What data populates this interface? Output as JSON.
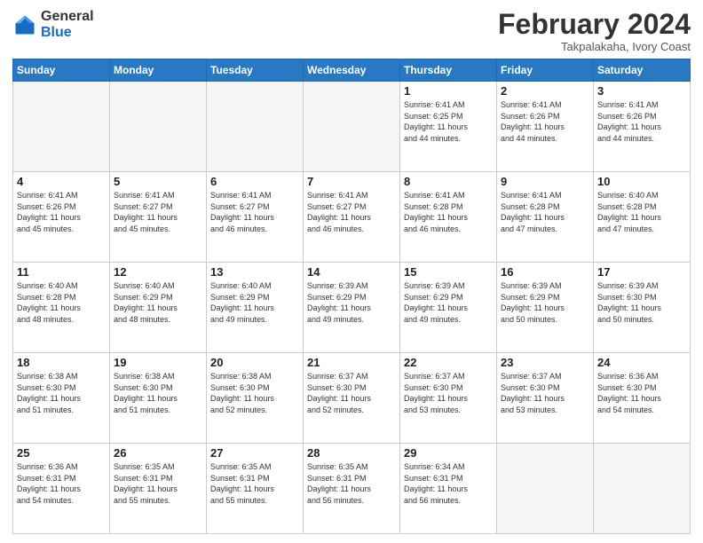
{
  "logo": {
    "general": "General",
    "blue": "Blue"
  },
  "header": {
    "title": "February 2024",
    "subtitle": "Takpalakaha, Ivory Coast"
  },
  "weekdays": [
    "Sunday",
    "Monday",
    "Tuesday",
    "Wednesday",
    "Thursday",
    "Friday",
    "Saturday"
  ],
  "weeks": [
    [
      {
        "day": "",
        "info": ""
      },
      {
        "day": "",
        "info": ""
      },
      {
        "day": "",
        "info": ""
      },
      {
        "day": "",
        "info": ""
      },
      {
        "day": "1",
        "info": "Sunrise: 6:41 AM\nSunset: 6:25 PM\nDaylight: 11 hours\nand 44 minutes."
      },
      {
        "day": "2",
        "info": "Sunrise: 6:41 AM\nSunset: 6:26 PM\nDaylight: 11 hours\nand 44 minutes."
      },
      {
        "day": "3",
        "info": "Sunrise: 6:41 AM\nSunset: 6:26 PM\nDaylight: 11 hours\nand 44 minutes."
      }
    ],
    [
      {
        "day": "4",
        "info": "Sunrise: 6:41 AM\nSunset: 6:26 PM\nDaylight: 11 hours\nand 45 minutes."
      },
      {
        "day": "5",
        "info": "Sunrise: 6:41 AM\nSunset: 6:27 PM\nDaylight: 11 hours\nand 45 minutes."
      },
      {
        "day": "6",
        "info": "Sunrise: 6:41 AM\nSunset: 6:27 PM\nDaylight: 11 hours\nand 46 minutes."
      },
      {
        "day": "7",
        "info": "Sunrise: 6:41 AM\nSunset: 6:27 PM\nDaylight: 11 hours\nand 46 minutes."
      },
      {
        "day": "8",
        "info": "Sunrise: 6:41 AM\nSunset: 6:28 PM\nDaylight: 11 hours\nand 46 minutes."
      },
      {
        "day": "9",
        "info": "Sunrise: 6:41 AM\nSunset: 6:28 PM\nDaylight: 11 hours\nand 47 minutes."
      },
      {
        "day": "10",
        "info": "Sunrise: 6:40 AM\nSunset: 6:28 PM\nDaylight: 11 hours\nand 47 minutes."
      }
    ],
    [
      {
        "day": "11",
        "info": "Sunrise: 6:40 AM\nSunset: 6:28 PM\nDaylight: 11 hours\nand 48 minutes."
      },
      {
        "day": "12",
        "info": "Sunrise: 6:40 AM\nSunset: 6:29 PM\nDaylight: 11 hours\nand 48 minutes."
      },
      {
        "day": "13",
        "info": "Sunrise: 6:40 AM\nSunset: 6:29 PM\nDaylight: 11 hours\nand 49 minutes."
      },
      {
        "day": "14",
        "info": "Sunrise: 6:39 AM\nSunset: 6:29 PM\nDaylight: 11 hours\nand 49 minutes."
      },
      {
        "day": "15",
        "info": "Sunrise: 6:39 AM\nSunset: 6:29 PM\nDaylight: 11 hours\nand 49 minutes."
      },
      {
        "day": "16",
        "info": "Sunrise: 6:39 AM\nSunset: 6:29 PM\nDaylight: 11 hours\nand 50 minutes."
      },
      {
        "day": "17",
        "info": "Sunrise: 6:39 AM\nSunset: 6:30 PM\nDaylight: 11 hours\nand 50 minutes."
      }
    ],
    [
      {
        "day": "18",
        "info": "Sunrise: 6:38 AM\nSunset: 6:30 PM\nDaylight: 11 hours\nand 51 minutes."
      },
      {
        "day": "19",
        "info": "Sunrise: 6:38 AM\nSunset: 6:30 PM\nDaylight: 11 hours\nand 51 minutes."
      },
      {
        "day": "20",
        "info": "Sunrise: 6:38 AM\nSunset: 6:30 PM\nDaylight: 11 hours\nand 52 minutes."
      },
      {
        "day": "21",
        "info": "Sunrise: 6:37 AM\nSunset: 6:30 PM\nDaylight: 11 hours\nand 52 minutes."
      },
      {
        "day": "22",
        "info": "Sunrise: 6:37 AM\nSunset: 6:30 PM\nDaylight: 11 hours\nand 53 minutes."
      },
      {
        "day": "23",
        "info": "Sunrise: 6:37 AM\nSunset: 6:30 PM\nDaylight: 11 hours\nand 53 minutes."
      },
      {
        "day": "24",
        "info": "Sunrise: 6:36 AM\nSunset: 6:30 PM\nDaylight: 11 hours\nand 54 minutes."
      }
    ],
    [
      {
        "day": "25",
        "info": "Sunrise: 6:36 AM\nSunset: 6:31 PM\nDaylight: 11 hours\nand 54 minutes."
      },
      {
        "day": "26",
        "info": "Sunrise: 6:35 AM\nSunset: 6:31 PM\nDaylight: 11 hours\nand 55 minutes."
      },
      {
        "day": "27",
        "info": "Sunrise: 6:35 AM\nSunset: 6:31 PM\nDaylight: 11 hours\nand 55 minutes."
      },
      {
        "day": "28",
        "info": "Sunrise: 6:35 AM\nSunset: 6:31 PM\nDaylight: 11 hours\nand 56 minutes."
      },
      {
        "day": "29",
        "info": "Sunrise: 6:34 AM\nSunset: 6:31 PM\nDaylight: 11 hours\nand 56 minutes."
      },
      {
        "day": "",
        "info": ""
      },
      {
        "day": "",
        "info": ""
      }
    ]
  ]
}
